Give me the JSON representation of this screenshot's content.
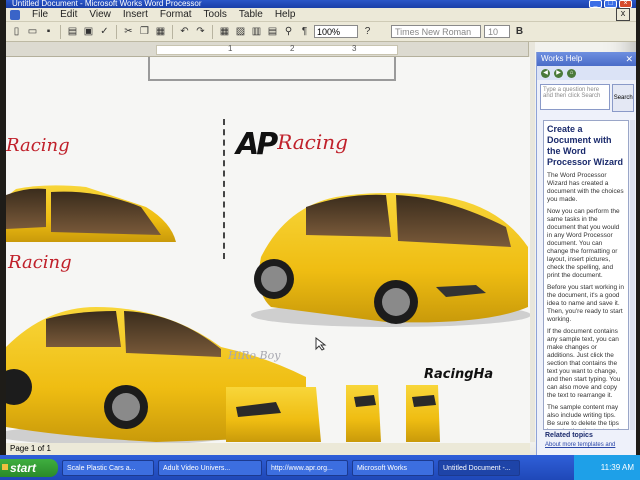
{
  "window": {
    "title": "Untitled Document - Microsoft Works Word Processor"
  },
  "menu": {
    "items": [
      "File",
      "Edit",
      "View",
      "Insert",
      "Format",
      "Tools",
      "Table",
      "Help"
    ],
    "close_glyph": "x"
  },
  "toolbar": {
    "zoom": "100%",
    "font": "Times New Roman",
    "size": "10"
  },
  "ruler": {
    "marks": [
      "1",
      "2",
      "3"
    ]
  },
  "document": {
    "logo_ap": "AP",
    "logo_racing": "Racing",
    "racing_left": "Racing",
    "racing_left_top": "Racing",
    "racing_haus": "RacingHa",
    "hiro_boy": "HiRo Boy"
  },
  "status": {
    "page": "Page 1 of 1"
  },
  "task_pane": {
    "header": "Works Help",
    "search_placeholder": "Type a question here and then click Search",
    "search_button": "Search",
    "title": "Create a Document with the Word Processor Wizard",
    "paragraphs": [
      "The Word Processor Wizard has created a document with the choices you made.",
      "Now you can perform the same tasks in the document that you would in any Word Processor document. You can change the formatting or layout, insert pictures, check the spelling, and print the document.",
      "Before you start working in the document, it's a good idea to name and save it. Then, you're ready to start working.",
      "If the document contains any sample text, you can make changes or additions. Just click the section that contains the text you want to change, and then start typing. You can also move and copy the text to rearrange it.",
      "The sample content may also include writing tips. Be sure to delete the tips by selecting the text, and then pressing the DELETE key."
    ],
    "related_title": "Related topics",
    "related_link": "About more templates and"
  },
  "taskbar": {
    "start": "start",
    "buttons": [
      "Scale Plastic Cars a...",
      "Adult Video Univers...",
      "http://www.apr.org...",
      "Microsoft Works",
      "Untitled Document -..."
    ],
    "clock": "11:39 AM"
  },
  "colors": {
    "car_yellow": "#f2c21a",
    "racing_red": "#c0202a",
    "taskbar_blue": "#2a56c8"
  }
}
